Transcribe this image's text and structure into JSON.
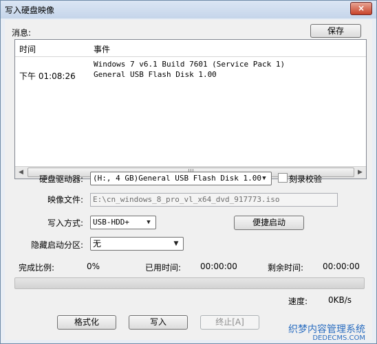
{
  "window": {
    "title": "写入硬盘映像",
    "close_glyph": "×"
  },
  "messages_label": "消息:",
  "save_button": "保存",
  "log": {
    "col_time": "时间",
    "col_event": "事件",
    "rows": [
      {
        "time": "",
        "event": "Windows 7 v6.1 Build 7601 (Service Pack 1)"
      },
      {
        "time": "下午 01:08:26",
        "event": "General USB Flash Disk  1.00"
      }
    ],
    "scroll_thumb_glyph": "|||"
  },
  "drive": {
    "label": "硬盘驱动器:",
    "value": "(H:, 4 GB)General USB Flash Disk  1.00"
  },
  "verify": {
    "label": "刻录校验",
    "checked": false
  },
  "image_file": {
    "label": "映像文件:",
    "value": "E:\\cn_windows_8_pro_vl_x64_dvd_917773.iso"
  },
  "write_mode": {
    "label": "写入方式:",
    "value": "USB-HDD+"
  },
  "quick_boot_button": "便捷启动",
  "hidden_partition": {
    "label": "隐藏启动分区:",
    "value": "无"
  },
  "stats": {
    "completed_label": "完成比例:",
    "completed_value": "0%",
    "elapsed_label": "已用时间:",
    "elapsed_value": "00:00:00",
    "remaining_label": "剩余时间:",
    "remaining_value": "00:00:00"
  },
  "progress": 0,
  "speed": {
    "label": "速度:",
    "value": "0KB/s"
  },
  "buttons": {
    "format": "格式化",
    "write": "写入",
    "abort": "终止[A]"
  },
  "watermark": {
    "line1": "织梦内容管理系统",
    "line2": "DEDECMS.COM"
  },
  "colors": {
    "progress_fill": "#06b025",
    "watermark": "#2a6dc0"
  }
}
